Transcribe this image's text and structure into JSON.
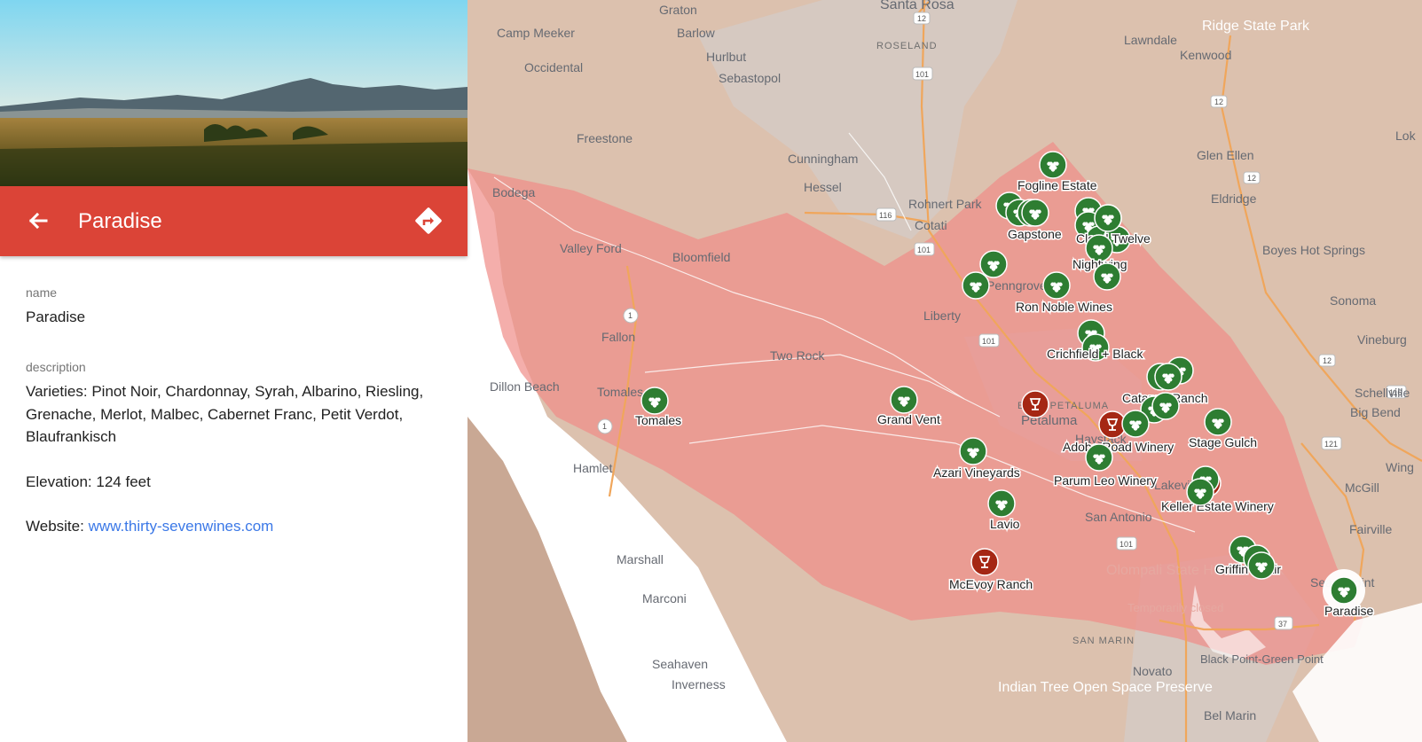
{
  "panel": {
    "title": "Paradise",
    "fields": {
      "name_label": "name",
      "name_value": "Paradise",
      "description_label": "description",
      "varieties": "Varieties: Pinot Noir, Chardonnay, Syrah, Albarino, Riesling, Grenache, Merlot, Malbec, Cabernet Franc, Petit Verdot, Blaufrankisch",
      "elevation": "Elevation: 124 feet",
      "website_prefix": "Website: ",
      "website_link": "www.thirty-sevenwines.com"
    },
    "icons": {
      "back": "arrow-back-icon",
      "directions": "directions-icon"
    }
  },
  "colors": {
    "header": "#db4437",
    "region_fill": "#f08c87",
    "winery_marker": "#2e7d32",
    "tasting_room_marker": "#a52714",
    "link": "#3b78e7",
    "land": "#dcc1ae"
  },
  "map": {
    "places": [
      "Graton",
      "Camp Meeker",
      "Barlow",
      "Santa Rosa",
      "ROSELAND",
      "Occidental",
      "Hurlbut",
      "Sebastopol",
      "Freestone",
      "Cunningham",
      "Hessel",
      "Bodega",
      "Rohnert Park",
      "Cotati",
      "Valley Ford",
      "Bloomfield",
      "Fallon",
      "Liberty",
      "Two Rock",
      "Dillon Beach",
      "Tomales",
      "EAST PETALUMA",
      "Petaluma",
      "Haystack",
      "Lakeville",
      "San Antonio",
      "Hamlet",
      "Marshall",
      "Marconi",
      "Seahaven",
      "Inverness",
      "SAN MARIN",
      "Black Point-Green Point",
      "Novato",
      "Bel Marin",
      "Lawndale",
      "Kenwood",
      "Glen Ellen",
      "Eldridge",
      "Boyes Hot Springs",
      "Sonoma",
      "Vineburg",
      "Schellville",
      "Big Bend",
      "McGill",
      "Fairville",
      "Sears Point",
      "Ridge State Park",
      "Wing",
      "Lok",
      "Penngrove"
    ],
    "park_label": "Olompali State Historic Park",
    "park_note": "Temporarily closed",
    "preserve_label": "Indian Tree Open Space Preserve",
    "routes": [
      "12",
      "101",
      "116",
      "1",
      "37",
      "121"
    ],
    "wineries": [
      "Fogline Estate",
      "Gapstone",
      "Cloud Twelve",
      "Nightwing",
      "Ron Noble Wines",
      "Crichfield + Black",
      "Catapult Ranch",
      "Stage Gulch",
      "Adobe Road Winery",
      "Parum Leo Winery",
      "Keller Estate Winery",
      "Griffin's Lair",
      "Paradise",
      "Tomales",
      "Grand Vent",
      "Azari Vineyards",
      "Lavio",
      "McEvoy Ranch"
    ]
  }
}
